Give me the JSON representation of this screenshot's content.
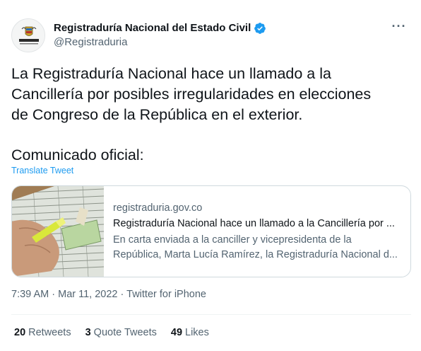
{
  "author": {
    "display_name": "Registraduría Nacional del Estado Civil",
    "handle": "@Registraduria",
    "avatar_text": "REGISTRADURÍA",
    "verified_color": "#1d9bf0"
  },
  "tweet": {
    "text_line1": "La Registraduría Nacional hace un llamado a la",
    "text_line2": "Cancillería por posibles irregularidades en elecciones",
    "text_line3": "de Congreso de la República en el exterior.",
    "text_line4": "Comunicado oficial:",
    "translate_label": "Translate Tweet"
  },
  "link_card": {
    "domain": "registraduria.gov.co",
    "title": "Registraduría Nacional hace un llamado a la Cancillería por ...",
    "description_line1": "En carta enviada a la canciller y vicepresidenta de la",
    "description_line2": "República, Marta Lucía Ramírez, la Registraduría Nacional d..."
  },
  "meta": {
    "time": "7:39 AM",
    "separator": "·",
    "date": "Mar 11, 2022",
    "source": "Twitter for iPhone"
  },
  "stats": {
    "retweets_count": "20",
    "retweets_label": "Retweets",
    "quotes_count": "3",
    "quotes_label": "Quote Tweets",
    "likes_count": "49",
    "likes_label": "Likes"
  },
  "more_icon": "more-horizontal-icon"
}
